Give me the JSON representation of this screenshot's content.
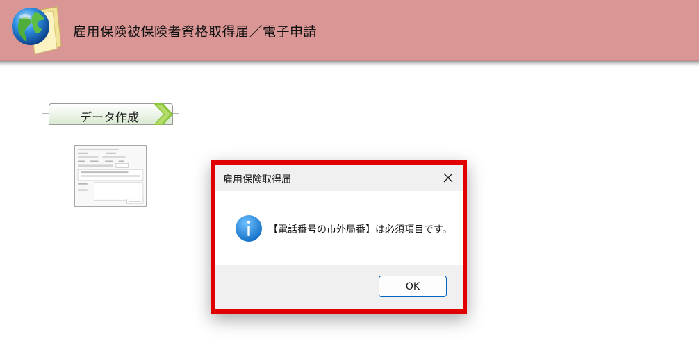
{
  "header": {
    "title": "雇用保険被保険者資格取得届／電子申請",
    "icon": "globe-document-icon"
  },
  "card": {
    "tab_label": "データ作成",
    "arrow_icon": "chevron-right-icon",
    "thumbnail": "form-preview-thumbnail"
  },
  "dialog": {
    "title": "雇用保険取得届",
    "close_icon": "close-icon",
    "icon": "info-icon",
    "message": "【電話番号の市外局番】は必須項目です。",
    "ok_label": "OK"
  },
  "colors": {
    "banner": "#d99694",
    "highlight_border": "#e10000",
    "ok_border": "#0067c0",
    "info_blue": "#1b7fd1"
  }
}
